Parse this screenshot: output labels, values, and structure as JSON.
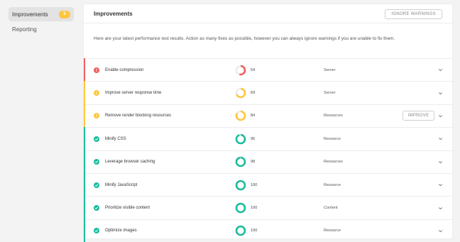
{
  "sidebar": {
    "items": [
      {
        "label": "Improvements",
        "badge": "5",
        "active": true
      },
      {
        "label": "Reporting"
      }
    ]
  },
  "card": {
    "title": "Improvements",
    "ignore_button": "IGNORE WARNINGS",
    "intro": "Here are your latest performance test results. Action as many fixes as possible, however you can always ignore warnings if you are unable to fix them."
  },
  "colors": {
    "error": "#ee5d5d",
    "warning": "#ffc53d",
    "success": "#1abc9c"
  },
  "rows": [
    {
      "status": "error",
      "title": "Enable compression",
      "score": 54,
      "type": "Server"
    },
    {
      "status": "warning",
      "title": "Improve server response time",
      "score": 69,
      "type": "Server"
    },
    {
      "status": "warning",
      "title": "Remove render blocking resources",
      "score": 84,
      "type": "Resources",
      "action": "IMPROVE"
    },
    {
      "status": "success",
      "title": "Minify CSS",
      "score": 95,
      "type": "Resource"
    },
    {
      "status": "success",
      "title": "Leverage browser caching",
      "score": 98,
      "type": "Resources"
    },
    {
      "status": "success",
      "title": "Minify JavaScript",
      "score": 100,
      "type": "Resource"
    },
    {
      "status": "success",
      "title": "Prioritize visible content",
      "score": 100,
      "type": "Content"
    },
    {
      "status": "success",
      "title": "Optimize images",
      "score": 100,
      "type": "Resource"
    }
  ]
}
